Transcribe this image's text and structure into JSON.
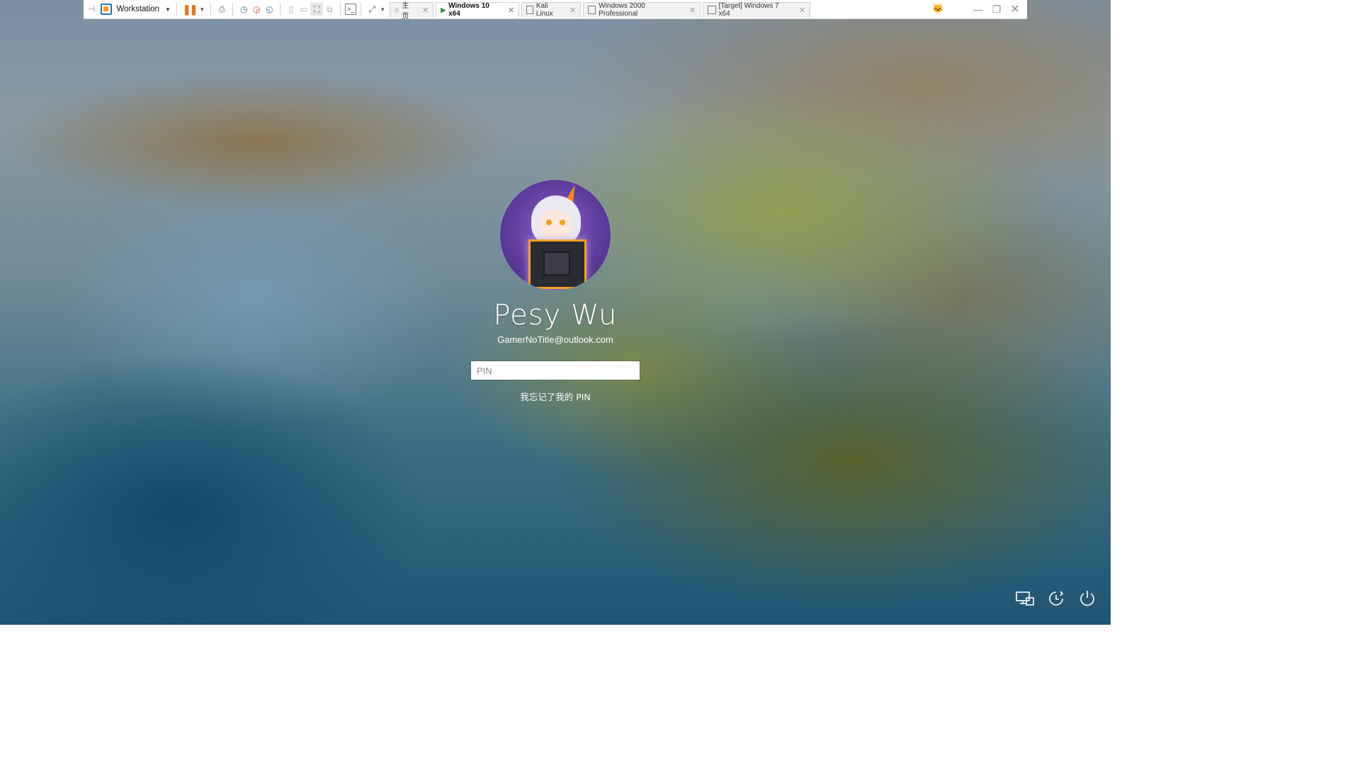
{
  "vmware": {
    "app_label": "Workstation",
    "tabs": [
      {
        "label": "主页",
        "icon": "home-icon",
        "active": false
      },
      {
        "label": "Windows 10 x64",
        "icon": "vm-running-icon",
        "active": true
      },
      {
        "label": "Kali Linux",
        "icon": "vm-icon",
        "active": false
      },
      {
        "label": "Windows 2000 Professional",
        "icon": "vm-icon",
        "active": false
      },
      {
        "label": "[Target] Windows 7 x64",
        "icon": "vm-icon",
        "active": false
      }
    ],
    "close_glyph": "✕",
    "accent_color": "#e3761b"
  },
  "login": {
    "user_name": "Pesy Wu",
    "email": "GamerNoTitle@outlook.com",
    "pin_placeholder": "PIN",
    "forgot_pin": "我忘记了我的 PIN"
  },
  "bottom_icons": [
    "network-icon",
    "accessibility-icon",
    "power-icon"
  ]
}
